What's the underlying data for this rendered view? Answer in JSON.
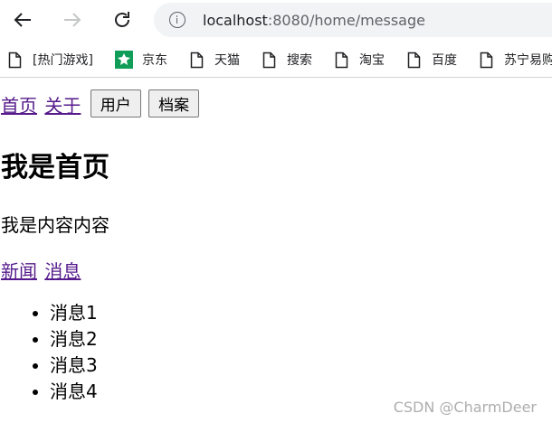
{
  "browser": {
    "address": {
      "host": "localhost",
      "rest": ":8080/home/message"
    },
    "bookmarks": [
      {
        "label": "[热门游戏]",
        "icon": "document-icon"
      },
      {
        "label": "京东",
        "icon": "jd-logo-icon"
      },
      {
        "label": "天猫",
        "icon": "document-icon"
      },
      {
        "label": "搜索",
        "icon": "document-icon"
      },
      {
        "label": "淘宝",
        "icon": "document-icon"
      },
      {
        "label": "百度",
        "icon": "document-icon"
      },
      {
        "label": "苏宁易购",
        "icon": "document-icon"
      }
    ],
    "colors": {
      "jd_logo": "#0f9d58",
      "visited_link": "#551a8b"
    }
  },
  "page": {
    "nav": {
      "home_link": "首页",
      "about_link": "关于",
      "user_button": "用户",
      "profile_button": "档案"
    },
    "title": "我是首页",
    "content": "我是内容内容",
    "sub_nav": {
      "news_link": "新闻",
      "message_link": "消息"
    },
    "messages": [
      "消息1",
      "消息2",
      "消息3",
      "消息4"
    ]
  },
  "watermark": "CSDN @CharmDeer"
}
